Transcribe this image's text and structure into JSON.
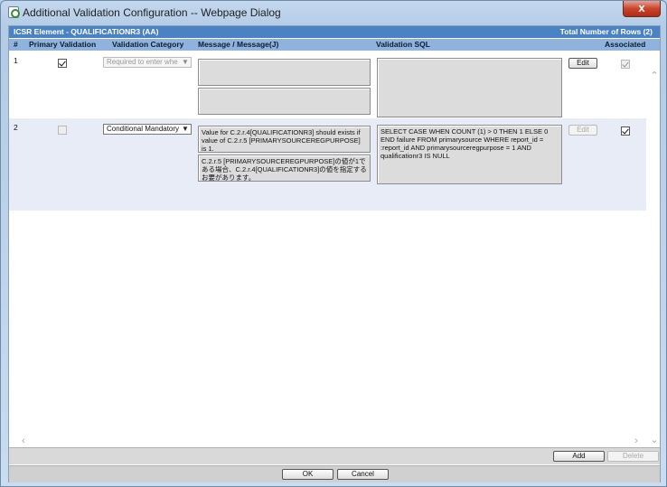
{
  "window": {
    "title": "Additional Validation Configuration -- Webpage Dialog",
    "close_label": "x"
  },
  "header": {
    "element_label": "ICSR Element - QUALIFICATIONR3 (AA)",
    "total_rows": "Total Number of Rows (2)"
  },
  "columns": {
    "num": "#",
    "primary": "Primary Validation",
    "category": "Validation Category",
    "message": "Message  /  Message(J)",
    "sql": "Validation SQL",
    "associated": "Associated"
  },
  "rows": [
    {
      "num": "1",
      "primary_checked": true,
      "primary_disabled": false,
      "category": "Required to enter whe",
      "category_disabled": true,
      "message": "",
      "message_j": "",
      "sql": "",
      "edit_label": "Edit",
      "edit_disabled": false,
      "associated_checked": true,
      "associated_disabled": true
    },
    {
      "num": "2",
      "primary_checked": false,
      "primary_disabled": true,
      "category": "Conditional Mandatory",
      "category_disabled": false,
      "message": "Value for C.2.r.4[QUALIFICATIONR3] should exists if value of C.2.r.5 [PRIMARYSOURCEREGPURPOSE] is 1.",
      "message_j": "C.2.r.5 [PRIMARYSOURCEREGPURPOSE]の値が1である場合、C.2.r.4[QUALIFICATIONR3]の値を指定するお要があります。",
      "sql": "SELECT CASE WHEN COUNT (1) > 0 THEN 1 ELSE 0 END failure FROM primarysource WHERE report_id = :report_id AND primarysourceregpurpose = 1 AND qualificationr3 IS NULL",
      "edit_label": "Edit",
      "edit_disabled": true,
      "associated_checked": true,
      "associated_disabled": false
    }
  ],
  "grid_footer": {
    "add_label": "Add",
    "delete_label": "Delete"
  },
  "dialog_footer": {
    "ok_label": "OK",
    "cancel_label": "Cancel"
  },
  "colors": {
    "header_bar": "#4a82c3",
    "column_bar": "#8fb3dc",
    "row_alt": "#e8ecf6",
    "close": "#c8452c"
  },
  "icons": {
    "title": "ie-page-icon",
    "close": "close-icon",
    "dropdown": "chevron-down-icon",
    "scroll_up": "scroll-up-icon",
    "scroll_down": "scroll-down-icon",
    "scroll_left": "scroll-left-icon",
    "scroll_right": "scroll-right-icon"
  }
}
